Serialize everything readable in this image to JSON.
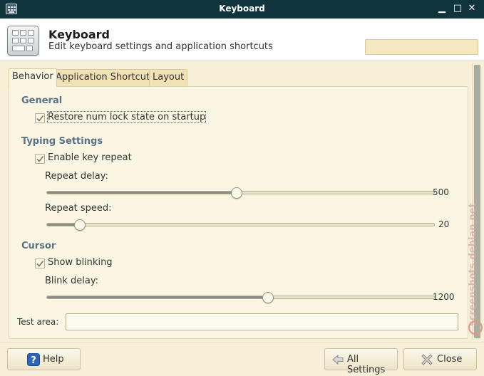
{
  "window": {
    "title": "Keyboard",
    "icon": "keyboard-icon",
    "controls": {
      "minimize": "▁",
      "maximize": "□",
      "close": "✕"
    }
  },
  "header": {
    "title": "Keyboard",
    "subtitle": "Edit keyboard settings and application shortcuts",
    "icon": "keyboard-icon"
  },
  "search": {
    "value": "",
    "placeholder": "",
    "icon": "search-icon"
  },
  "tabs": [
    {
      "label": "Behavior",
      "active": true
    },
    {
      "label": "Application Shortcuts",
      "active": false
    },
    {
      "label": "Layout",
      "active": false
    }
  ],
  "general": {
    "heading": "General",
    "numlock": {
      "label": "Restore num lock state on startup",
      "checked": true
    }
  },
  "typing": {
    "heading": "Typing Settings",
    "key_repeat": {
      "label": "Enable key repeat",
      "checked": true
    },
    "repeat_delay": {
      "label": "Repeat delay:",
      "value": "500",
      "fraction": 0.49
    },
    "repeat_speed": {
      "label": "Repeat speed:",
      "value": "20",
      "fraction": 0.087
    }
  },
  "cursor": {
    "heading": "Cursor",
    "blinking": {
      "label": "Show blinking",
      "checked": true
    },
    "blink_delay": {
      "label": "Blink delay:",
      "value": "1200",
      "fraction": 0.57
    }
  },
  "test_area": {
    "label": "Test area:",
    "value": "",
    "placeholder": ""
  },
  "watermark": "screenshots.debian.net",
  "buttons": {
    "help": "Help",
    "all_settings": "All Settings",
    "close": "Close"
  },
  "colors": {
    "titlebar": "#10343e",
    "background": "#f7efd7",
    "panel": "#fbf5e4",
    "section_heading": "#587383",
    "search_bg": "#f5e8bf"
  }
}
